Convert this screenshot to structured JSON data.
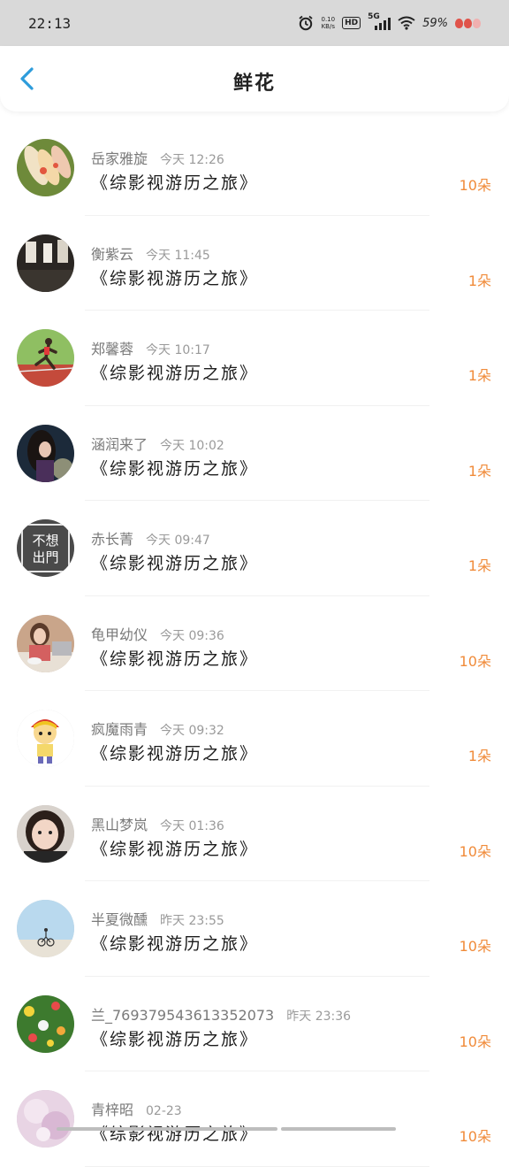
{
  "status_bar": {
    "time": "22:13",
    "net_speed_value": "0.10",
    "net_speed_unit": "KB/s",
    "hd_label": "HD",
    "signal_label": "5G",
    "battery": "59%"
  },
  "header": {
    "title": "鲜花",
    "accent_color": "#2d9cdb"
  },
  "gifts": [
    {
      "user": "岳家雅旋",
      "time": "今天 12:26",
      "book": "《综影视游历之旅》",
      "count": "10朵",
      "avatar_icon": "avatar-spring-rolls"
    },
    {
      "user": "衡紫云",
      "time": "今天 11:45",
      "book": "《综影视游历之旅》",
      "count": "1朵",
      "avatar_icon": "avatar-dark-scene"
    },
    {
      "user": "郑馨蓉",
      "time": "今天 10:17",
      "book": "《综影视游历之旅》",
      "count": "1朵",
      "avatar_icon": "avatar-runner"
    },
    {
      "user": "涵润来了",
      "time": "今天 10:02",
      "book": "《综影视游历之旅》",
      "count": "1朵",
      "avatar_icon": "avatar-girl-dark"
    },
    {
      "user": "赤长菁",
      "time": "今天 09:47",
      "book": "《综影视游历之旅》",
      "count": "1朵",
      "avatar_icon": "avatar-text-sign",
      "avatar_text": "不想出門"
    },
    {
      "user": "龟甲幼仪",
      "time": "今天 09:36",
      "book": "《综影视游历之旅》",
      "count": "10朵",
      "avatar_icon": "avatar-girl-laptop"
    },
    {
      "user": "疯魔雨青",
      "time": "今天 09:32",
      "book": "《综影视游历之旅》",
      "count": "1朵",
      "avatar_icon": "avatar-cartoon-boy"
    },
    {
      "user": "黑山梦岚",
      "time": "今天 01:36",
      "book": "《综影视游历之旅》",
      "count": "10朵",
      "avatar_icon": "avatar-child"
    },
    {
      "user": "半夏微醺",
      "time": "昨天 23:55",
      "book": "《综影视游历之旅》",
      "count": "10朵",
      "avatar_icon": "avatar-cyclist-sky"
    },
    {
      "user": "兰_769379543613352073",
      "time": "昨天 23:36",
      "book": "《综影视游历之旅》",
      "count": "10朵",
      "avatar_icon": "avatar-flowers"
    },
    {
      "user": "青梓昭",
      "time": "02-23",
      "book": "《综影视游历之旅》",
      "count": "10朵",
      "avatar_icon": "avatar-pink-blur"
    }
  ]
}
